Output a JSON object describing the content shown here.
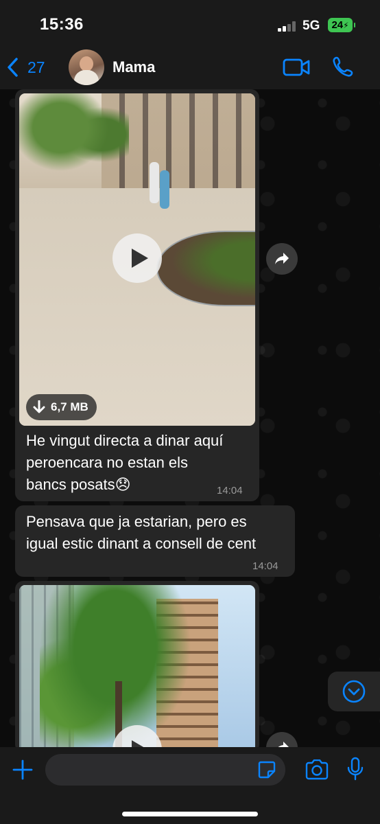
{
  "status_bar": {
    "time": "15:36",
    "network": "5G",
    "battery": "24"
  },
  "header": {
    "back_count": "27",
    "contact_name": "Mama",
    "icons": [
      "back-chevron-icon",
      "video-call-icon",
      "phone-icon"
    ]
  },
  "messages": [
    {
      "type": "video",
      "size": "6,7 MB",
      "caption_lines": [
        "He vingut directa a dinar aquí",
        "peroencara no estan els",
        "bancs posats😞"
      ],
      "time": "14:04"
    },
    {
      "type": "text",
      "lines": [
        "Pensava que ja estarian, pero es",
        "igual estic dinant a consell de cent"
      ],
      "time": "14:04"
    },
    {
      "type": "video"
    }
  ],
  "input_bar": {
    "placeholder": "",
    "icons": [
      "plus-icon",
      "sticker-icon",
      "camera-icon",
      "mic-icon"
    ]
  },
  "colors": {
    "accent": "#0a84ff",
    "bubble": "#262626",
    "bar": "#1a1a1a",
    "battery": "#3ec552"
  }
}
